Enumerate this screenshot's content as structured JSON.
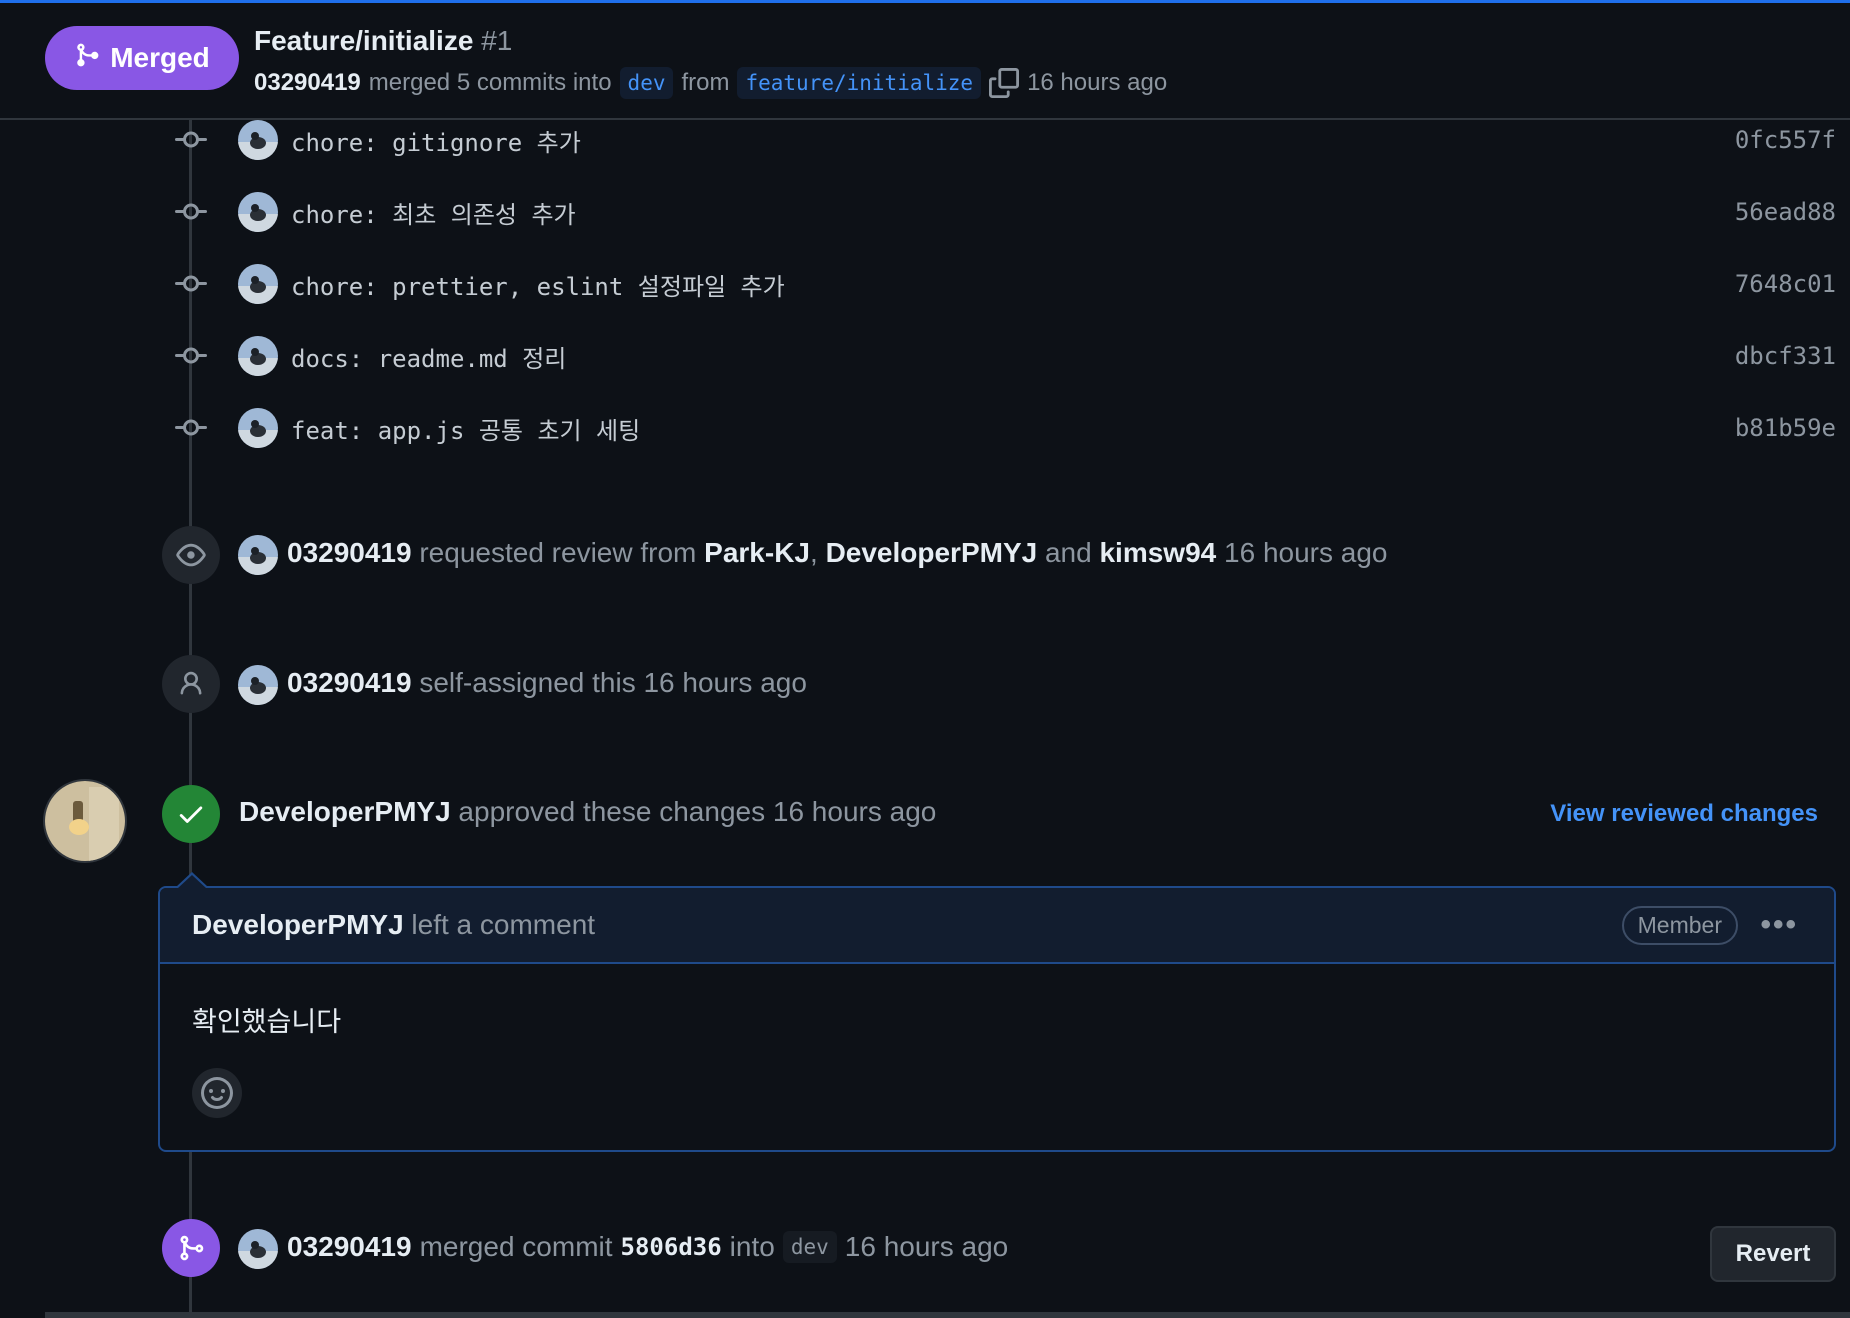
{
  "header": {
    "status": "Merged",
    "title": "Feature/initialize",
    "number": "#1",
    "author": "03290419",
    "merged_text": "merged 5 commits into",
    "base_branch": "dev",
    "from_text": "from",
    "head_branch": "feature/initialize",
    "time": "16 hours ago"
  },
  "commits": [
    {
      "message": "chore: gitignore 추가",
      "sha": "0fc557f"
    },
    {
      "message": "chore: 최초 의존성 추가",
      "sha": "56ead88"
    },
    {
      "message": "chore: prettier, eslint 설정파일 추가",
      "sha": "7648c01"
    },
    {
      "message": "docs: readme.md 정리",
      "sha": "dbcf331"
    },
    {
      "message": "feat: app.js 공통 초기 세팅",
      "sha": "b81b59e"
    }
  ],
  "review_request": {
    "actor": "03290419",
    "text": "requested review from",
    "reviewer1": "Park-KJ",
    "sep": ",",
    "reviewer2": "DeveloperPMYJ",
    "and_text": "and",
    "reviewer3": "kimsw94",
    "time": "16 hours ago"
  },
  "assign": {
    "actor": "03290419",
    "text": "self-assigned this 16 hours ago"
  },
  "approval": {
    "actor": "DeveloperPMYJ",
    "text": "approved these changes 16 hours ago",
    "view_link": "View reviewed changes"
  },
  "comment": {
    "author": "DeveloperPMYJ",
    "action": "left a comment",
    "role": "Member",
    "more": "•••",
    "body": "확인했습니다"
  },
  "merge_event": {
    "actor": "03290419",
    "text": "merged commit",
    "sha": "5806d36",
    "into_text": "into",
    "branch": "dev",
    "time": "16 hours ago",
    "revert_label": "Revert"
  },
  "colors": {
    "background": "#0d1117",
    "merged_purple": "#8957e5",
    "approved_green": "#238636",
    "link_blue": "#4493f8"
  },
  "icons": [
    "git-merge-icon",
    "copy-icon",
    "git-commit-icon",
    "eye-icon",
    "person-icon",
    "check-icon",
    "smiley-icon",
    "kebab-icon"
  ]
}
